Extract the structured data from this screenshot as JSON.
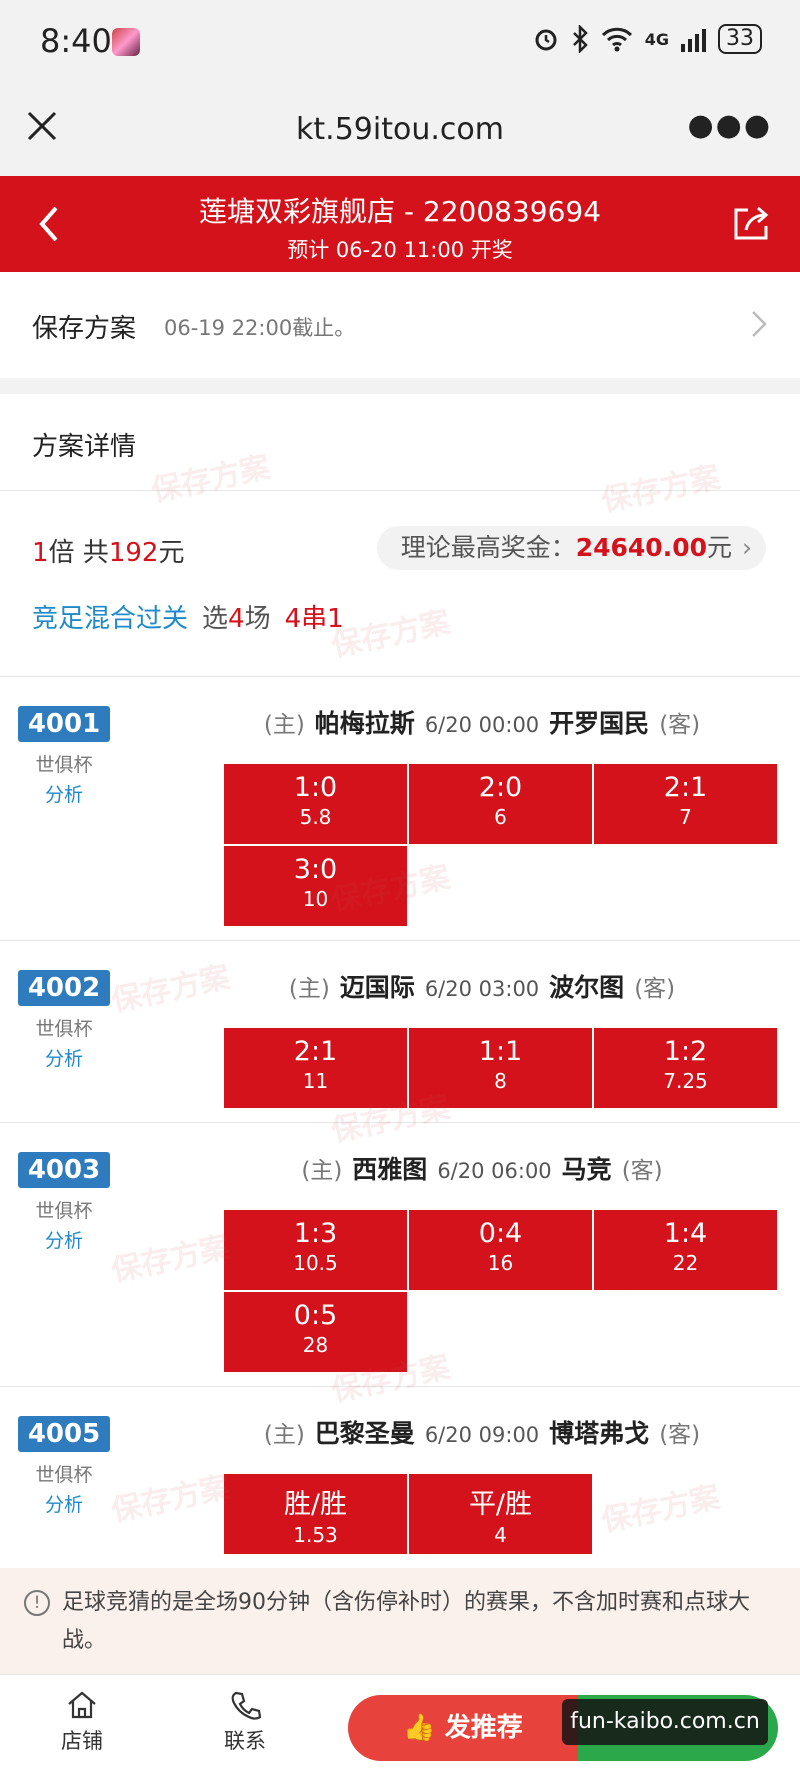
{
  "status": {
    "time": "8:40",
    "network": "4G",
    "battery": "33"
  },
  "urlbar": {
    "url": "kt.59itou.com"
  },
  "header": {
    "store": "莲塘双彩旗舰店 - 2200839694",
    "draw": "预计 06-20 11:00 开奖"
  },
  "save": {
    "title": "保存方案",
    "deadline": "06-19 22:00截止。"
  },
  "detail": {
    "title": "方案详情",
    "multiple": "1",
    "multiple_unit": "倍 共",
    "total": "192",
    "total_unit": "元",
    "prize_label": "理论最高奖金：",
    "prize_amount": "24640.00",
    "prize_unit": "元",
    "play_type": "竞足混合过关",
    "select_prefix": "选",
    "select_count": "4",
    "select_suffix": "场",
    "pass": "4串1"
  },
  "matches": [
    {
      "code": "4001",
      "league": "世俱杯",
      "analysis": "分析",
      "home_tag": "(主)",
      "home": "帕梅拉斯",
      "time": "6/20 00:00",
      "away": "开罗国民",
      "away_tag": "(客)",
      "picks": [
        {
          "score": "1:0",
          "odds": "5.8"
        },
        {
          "score": "2:0",
          "odds": "6"
        },
        {
          "score": "2:1",
          "odds": "7"
        },
        {
          "score": "3:0",
          "odds": "10"
        }
      ]
    },
    {
      "code": "4002",
      "league": "世俱杯",
      "analysis": "分析",
      "home_tag": "(主)",
      "home": "迈国际",
      "time": "6/20 03:00",
      "away": "波尔图",
      "away_tag": "(客)",
      "picks": [
        {
          "score": "2:1",
          "odds": "11"
        },
        {
          "score": "1:1",
          "odds": "8"
        },
        {
          "score": "1:2",
          "odds": "7.25"
        }
      ]
    },
    {
      "code": "4003",
      "league": "世俱杯",
      "analysis": "分析",
      "home_tag": "(主)",
      "home": "西雅图",
      "time": "6/20 06:00",
      "away": "马竞",
      "away_tag": "(客)",
      "picks": [
        {
          "score": "1:3",
          "odds": "10.5"
        },
        {
          "score": "0:4",
          "odds": "16"
        },
        {
          "score": "1:4",
          "odds": "22"
        },
        {
          "score": "0:5",
          "odds": "28"
        }
      ]
    },
    {
      "code": "4005",
      "league": "世俱杯",
      "analysis": "分析",
      "home_tag": "(主)",
      "home": "巴黎圣曼",
      "time": "6/20 09:00",
      "away": "博塔弗戈",
      "away_tag": "(客)",
      "picks": [
        {
          "score": "胜/胜",
          "odds": "1.53"
        },
        {
          "score": "平/胜",
          "odds": "4"
        }
      ]
    }
  ],
  "watermark_text": "保存方案",
  "notice": {
    "text": "足球竞猜的是全场90分钟（含伤停补时）的赛果，不含加时赛和点球大战。"
  },
  "bottom": {
    "store": "店铺",
    "contact": "联系",
    "recommend": "发推荐",
    "site_label": "fun-kaibo.com.cn"
  },
  "colors": {
    "accent_red": "#d4121b",
    "badge_blue": "#2e7bbd",
    "link_blue": "#1f8ac9",
    "green": "#2aa84a"
  }
}
